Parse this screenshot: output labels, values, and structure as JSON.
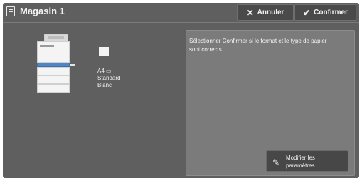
{
  "header": {
    "title": "Magasin 1",
    "title_icon": "document-list-icon",
    "cancel_label": "Annuler",
    "cancel_icon": "close-icon",
    "confirm_label": "Confirmer",
    "confirm_icon": "check-icon"
  },
  "tray": {
    "device_icon": "printer-icon",
    "paper_icon": "paper-icon",
    "paper_info": "A4 ▭\nStandard\nBlanc"
  },
  "message": {
    "text": "Sélectionner Confirmer si le format et le type de papier sont corrects."
  },
  "actions": {
    "modify_label": "Modifier les\nparamètres...",
    "modify_icon": "pencil-icon"
  },
  "colors": {
    "panel": "#5f5f5f",
    "message_box": "#7b7b7b",
    "button": "#4a4a4a",
    "text": "#f0f0f0"
  }
}
